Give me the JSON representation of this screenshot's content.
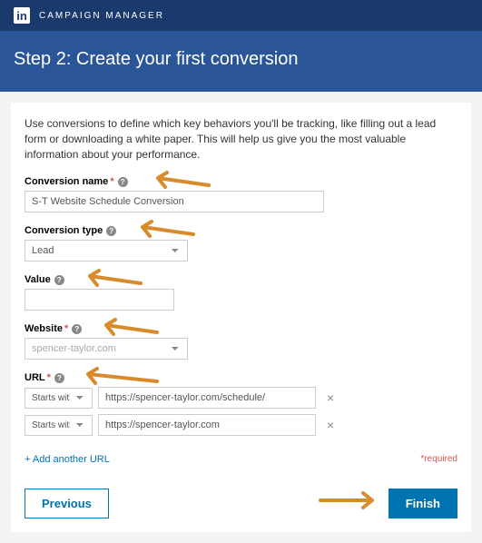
{
  "header": {
    "app_label": "CAMPAIGN MANAGER",
    "logo_text": "in"
  },
  "step": {
    "title": "Step 2: Create your first conversion"
  },
  "intro": "Use conversions to define which key behaviors you'll be tracking, like filling out a lead form or downloading a white paper. This will help us give you the most valuable information about your performance.",
  "fields": {
    "conversion_name": {
      "label": "Conversion name",
      "value": "S-T Website Schedule Conversion"
    },
    "conversion_type": {
      "label": "Conversion type",
      "value": "Lead"
    },
    "value": {
      "label": "Value",
      "value": ""
    },
    "website": {
      "label": "Website",
      "value": "spencer-taylor.com"
    },
    "url": {
      "label": "URL",
      "rows": [
        {
          "match": "Starts with",
          "value": "https://spencer-taylor.com/schedule/"
        },
        {
          "match": "Starts with",
          "value": "https://spencer-taylor.com"
        }
      ]
    }
  },
  "add_url": "+ Add another URL",
  "required_text": "*required",
  "buttons": {
    "previous": "Previous",
    "finish": "Finish"
  }
}
